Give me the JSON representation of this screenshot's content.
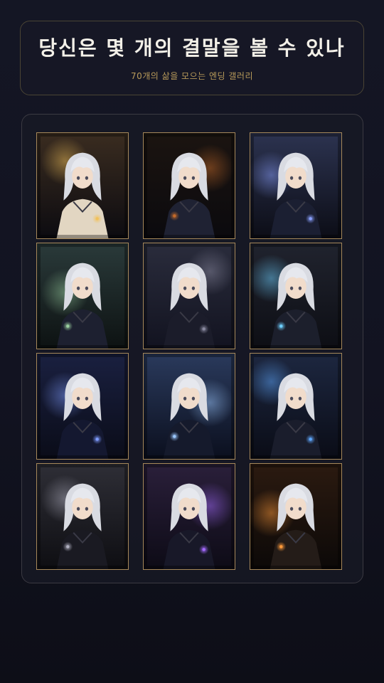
{
  "header": {
    "title": "당신은 몇 개의 결말을 볼 수 있나",
    "subtitle": "70개의 삶을 모으는 엔딩 갤러리"
  },
  "colors": {
    "frame_border": "#a6885a",
    "title_text": "#f3f0e8",
    "subtitle_text": "#b89a5a",
    "background": "#141624"
  },
  "gallery": {
    "items": [
      {
        "scene": "lantern",
        "bg": [
          "#3a2c20",
          "#0c0b10"
        ],
        "glow": "#f2c15a",
        "outfit": "#e2d6c2"
      },
      {
        "scene": "doorway",
        "bg": [
          "#1b1410",
          "#0b0a0e"
        ],
        "glow": "#c46a2a",
        "outfit": "#1f2233"
      },
      {
        "scene": "cliff-map",
        "bg": [
          "#2c3350",
          "#0c0d16"
        ],
        "glow": "#8aa0ff",
        "outfit": "#1b1f32"
      },
      {
        "scene": "alchemy",
        "bg": [
          "#2a3a3a",
          "#0d1212"
        ],
        "glow": "#9bd0a0",
        "outfit": "#1d2030"
      },
      {
        "scene": "portrait",
        "bg": [
          "#2a2c3c",
          "#121320"
        ],
        "glow": "#8a8aa0",
        "outfit": "#1b1c2a"
      },
      {
        "scene": "spark-book",
        "bg": [
          "#20232e",
          "#0d0e14"
        ],
        "glow": "#6fd0ff",
        "outfit": "#1c1f2c"
      },
      {
        "scene": "night-robe",
        "bg": [
          "#1a2040",
          "#0a0c18"
        ],
        "glow": "#7f9cff",
        "outfit": "#141830"
      },
      {
        "scene": "storm",
        "bg": [
          "#2a3a5c",
          "#0b0f1e"
        ],
        "glow": "#9cc8ff",
        "outfit": "#151a2c"
      },
      {
        "scene": "ritual",
        "bg": [
          "#1d2740",
          "#0a0c16"
        ],
        "glow": "#5fa8ff",
        "outfit": "#1a1d2c"
      },
      {
        "scene": "grimoire",
        "bg": [
          "#2e2e36",
          "#0e0e12"
        ],
        "glow": "#b0b0c0",
        "outfit": "#1a1a22"
      },
      {
        "scene": "violet-magic",
        "bg": [
          "#2a1f3a",
          "#0d0b16"
        ],
        "glow": "#a46bff",
        "outfit": "#181828"
      },
      {
        "scene": "forge",
        "bg": [
          "#2b1a10",
          "#0c0908"
        ],
        "glow": "#ff9a3a",
        "outfit": "#241c18"
      }
    ]
  }
}
